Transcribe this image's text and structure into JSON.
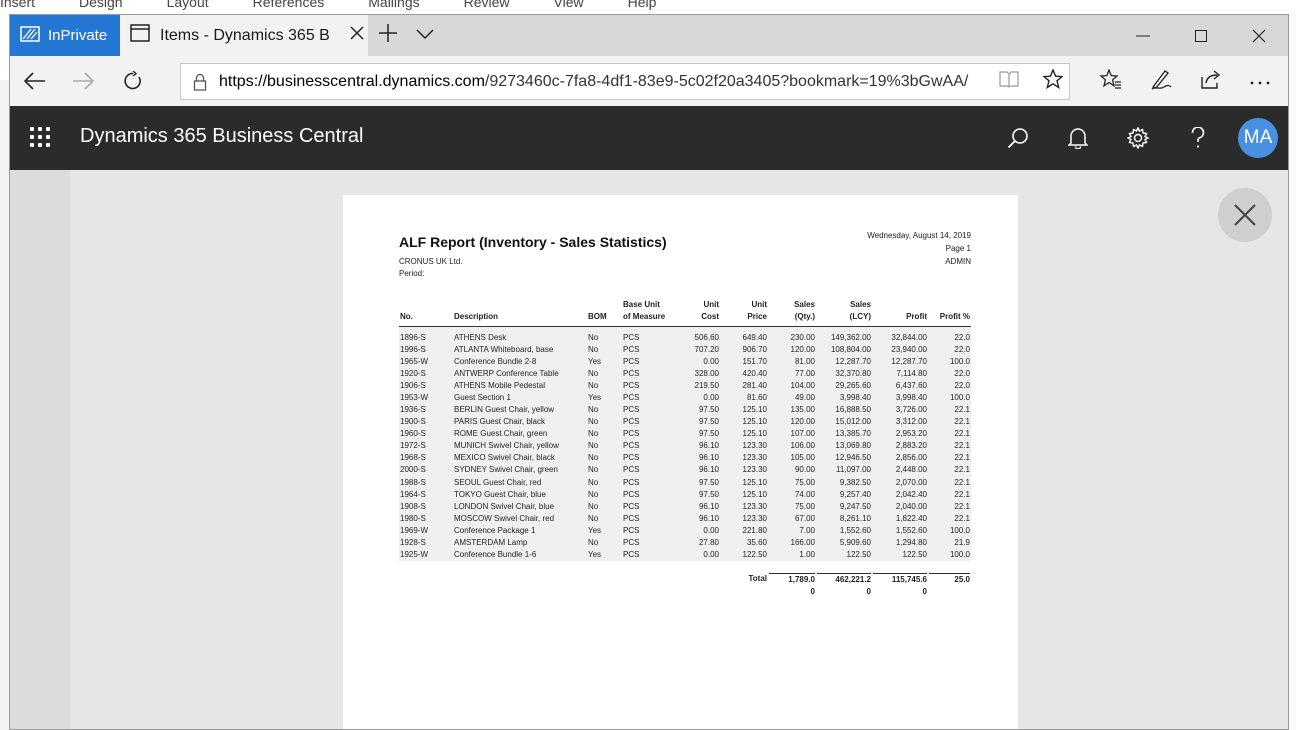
{
  "background_app": {
    "menu": [
      "Insert",
      "Design",
      "Layout",
      "References",
      "Mailings",
      "Review",
      "View",
      "Help"
    ]
  },
  "browser": {
    "inprivate_label": "InPrivate",
    "tab_title": "Items - Dynamics 365 B",
    "url_host": "https://businesscentral.dynamics.com",
    "url_path": "/9273460c-7fa8-4df1-83e9-5c02f20a3405?bookmark=19%3bGwAA/"
  },
  "app": {
    "title": "Dynamics 365 Business Central",
    "avatar_initials": "MA"
  },
  "report": {
    "title": "ALF Report (Inventory - Sales Statistics)",
    "company": "CRONUS UK Ltd.",
    "period_label": "Period:",
    "date": "Wednesday, August 14, 2019",
    "page": "Page 1",
    "user": "ADMIN",
    "columns": {
      "no": "No.",
      "description": "Description",
      "bom": "BOM",
      "uom1": "Base Unit",
      "uom2": "of Measure",
      "unit_cost1": "Unit",
      "unit_cost2": "Cost",
      "unit_price1": "Unit",
      "unit_price2": "Price",
      "sales_qty1": "Sales",
      "sales_qty2": "(Qty.)",
      "sales_lcy1": "Sales",
      "sales_lcy2": "(LCY)",
      "profit": "Profit",
      "profit_pct": "Profit %"
    },
    "rows": [
      {
        "no": "1896-S",
        "desc": "ATHENS Desk",
        "bom": "No",
        "uom": "PCS",
        "cost": "506.60",
        "price": "649.40",
        "qty": "230.00",
        "sales": "149,362.00",
        "profit": "32,844.00",
        "pct": "22.0"
      },
      {
        "no": "1996-S",
        "desc": "ATLANTA Whiteboard, base",
        "bom": "No",
        "uom": "PCS",
        "cost": "707.20",
        "price": "906.70",
        "qty": "120.00",
        "sales": "108,804.00",
        "profit": "23,940.00",
        "pct": "22.0"
      },
      {
        "no": "1965-W",
        "desc": "Conference Bundle 2-8",
        "bom": "Yes",
        "uom": "PCS",
        "cost": "0.00",
        "price": "151.70",
        "qty": "81.00",
        "sales": "12,287.70",
        "profit": "12,287.70",
        "pct": "100.0"
      },
      {
        "no": "1920-S",
        "desc": "ANTWERP Conference Table",
        "bom": "No",
        "uom": "PCS",
        "cost": "328.00",
        "price": "420.40",
        "qty": "77.00",
        "sales": "32,370.80",
        "profit": "7,114.80",
        "pct": "22.0"
      },
      {
        "no": "1906-S",
        "desc": "ATHENS Mobile Pedestal",
        "bom": "No",
        "uom": "PCS",
        "cost": "219.50",
        "price": "281.40",
        "qty": "104.00",
        "sales": "29,265.60",
        "profit": "6,437.60",
        "pct": "22.0"
      },
      {
        "no": "1953-W",
        "desc": "Guest Section 1",
        "bom": "Yes",
        "uom": "PCS",
        "cost": "0.00",
        "price": "81.60",
        "qty": "49.00",
        "sales": "3,998.40",
        "profit": "3,998.40",
        "pct": "100.0"
      },
      {
        "no": "1936-S",
        "desc": "BERLIN Guest Chair, yellow",
        "bom": "No",
        "uom": "PCS",
        "cost": "97.50",
        "price": "125.10",
        "qty": "135.00",
        "sales": "16,888.50",
        "profit": "3,726.00",
        "pct": "22.1"
      },
      {
        "no": "1900-S",
        "desc": "PARIS Guest Chair, black",
        "bom": "No",
        "uom": "PCS",
        "cost": "97.50",
        "price": "125.10",
        "qty": "120.00",
        "sales": "15,012.00",
        "profit": "3,312.00",
        "pct": "22.1"
      },
      {
        "no": "1960-S",
        "desc": "ROME Guest Chair, green",
        "bom": "No",
        "uom": "PCS",
        "cost": "97.50",
        "price": "125.10",
        "qty": "107.00",
        "sales": "13,385.70",
        "profit": "2,953.20",
        "pct": "22.1"
      },
      {
        "no": "1972-S",
        "desc": "MUNICH Swivel Chair, yellow",
        "bom": "No",
        "uom": "PCS",
        "cost": "96.10",
        "price": "123.30",
        "qty": "106.00",
        "sales": "13,069.80",
        "profit": "2,883.20",
        "pct": "22.1"
      },
      {
        "no": "1968-S",
        "desc": "MEXICO Swivel Chair, black",
        "bom": "No",
        "uom": "PCS",
        "cost": "96.10",
        "price": "123.30",
        "qty": "105.00",
        "sales": "12,946.50",
        "profit": "2,856.00",
        "pct": "22.1"
      },
      {
        "no": "2000-S",
        "desc": "SYDNEY Swivel Chair, green",
        "bom": "No",
        "uom": "PCS",
        "cost": "96.10",
        "price": "123.30",
        "qty": "90.00",
        "sales": "11,097.00",
        "profit": "2,448.00",
        "pct": "22.1"
      },
      {
        "no": "1988-S",
        "desc": "SEOUL Guest Chair, red",
        "bom": "No",
        "uom": "PCS",
        "cost": "97.50",
        "price": "125.10",
        "qty": "75.00",
        "sales": "9,382.50",
        "profit": "2,070.00",
        "pct": "22.1"
      },
      {
        "no": "1964-S",
        "desc": "TOKYO Guest Chair, blue",
        "bom": "No",
        "uom": "PCS",
        "cost": "97.50",
        "price": "125.10",
        "qty": "74.00",
        "sales": "9,257.40",
        "profit": "2,042.40",
        "pct": "22.1"
      },
      {
        "no": "1908-S",
        "desc": "LONDON Swivel Chair, blue",
        "bom": "No",
        "uom": "PCS",
        "cost": "96.10",
        "price": "123.30",
        "qty": "75.00",
        "sales": "9,247.50",
        "profit": "2,040.00",
        "pct": "22.1"
      },
      {
        "no": "1980-S",
        "desc": "MOSCOW Swivel Chair, red",
        "bom": "No",
        "uom": "PCS",
        "cost": "96.10",
        "price": "123.30",
        "qty": "67.00",
        "sales": "8,261.10",
        "profit": "1,822.40",
        "pct": "22.1"
      },
      {
        "no": "1969-W",
        "desc": "Conference Package 1",
        "bom": "Yes",
        "uom": "PCS",
        "cost": "0.00",
        "price": "221.80",
        "qty": "7.00",
        "sales": "1,552.60",
        "profit": "1,552.60",
        "pct": "100.0"
      },
      {
        "no": "1928-S",
        "desc": "AMSTERDAM Lamp",
        "bom": "No",
        "uom": "PCS",
        "cost": "27.80",
        "price": "35.60",
        "qty": "166.00",
        "sales": "5,909.60",
        "profit": "1,294.80",
        "pct": "21.9"
      },
      {
        "no": "1925-W",
        "desc": "Conference Bundle 1-6",
        "bom": "Yes",
        "uom": "PCS",
        "cost": "0.00",
        "price": "122.50",
        "qty": "1.00",
        "sales": "122.50",
        "profit": "122.50",
        "pct": "100.0"
      }
    ],
    "total": {
      "label": "Total",
      "qty_a": "1,789.0",
      "qty_b": "0",
      "sales_a": "462,221.2",
      "sales_b": "0",
      "profit_a": "115,745.6",
      "profit_b": "0",
      "pct": "25.0"
    }
  },
  "icons": {
    "inprivate": "inprivate-icon",
    "tab": "tab-page-icon",
    "close_tab": "close-icon",
    "new_tab": "plus-icon",
    "tab_list": "chevron-down-icon",
    "back": "back-arrow-icon",
    "forward": "forward-arrow-icon",
    "refresh": "refresh-icon",
    "lock": "lock-icon",
    "reading": "reading-view-icon",
    "favorite": "star-icon",
    "favorites": "favorites-icon",
    "pen": "pen-icon",
    "share": "share-icon",
    "more": "more-icon",
    "waffle": "app-launcher-icon",
    "search": "search-icon",
    "bell": "bell-icon",
    "settings": "gear-icon",
    "help": "help-icon"
  },
  "colors": {
    "inprivate_blue": "#2478d4",
    "bc_header": "#2b2b2b",
    "avatar": "#4a90e2"
  }
}
